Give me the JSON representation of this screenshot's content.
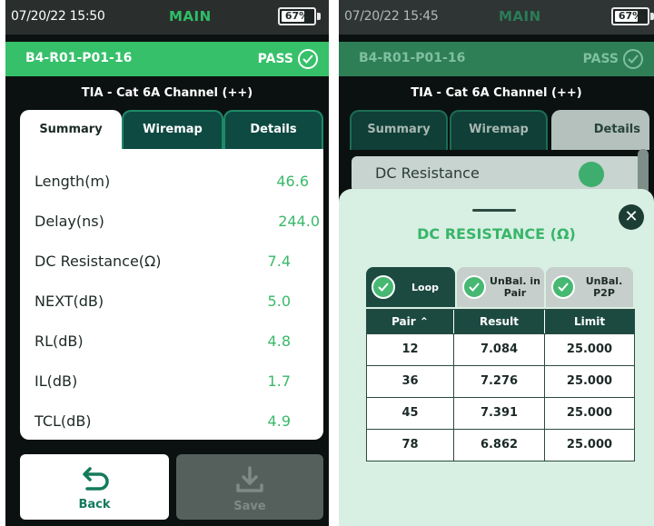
{
  "left": {
    "status": {
      "time": "07/20/22 15:50",
      "mode": "MAIN",
      "battery": "67%"
    },
    "result": {
      "cable_id": "B4-R01-P01-16",
      "status": "PASS"
    },
    "standard": "TIA - Cat 6A Channel (++)",
    "tabs": [
      "Summary",
      "Wiremap",
      "Details"
    ],
    "active_tab": "Summary",
    "rows": [
      {
        "label": "Length(m)",
        "value": "46.6"
      },
      {
        "label": "Delay(ns)",
        "value": "244.0"
      },
      {
        "label": "DC Resistance(Ω)",
        "value": "7.4"
      },
      {
        "label": "NEXT(dB)",
        "value": "5.0"
      },
      {
        "label": "RL(dB)",
        "value": "4.8"
      },
      {
        "label": "IL(dB)",
        "value": "1.7"
      },
      {
        "label": "TCL(dB)",
        "value": "4.9"
      }
    ],
    "buttons": {
      "back": "Back",
      "save": "Save"
    }
  },
  "right": {
    "status": {
      "time": "07/20/22 15:45",
      "mode": "MAIN",
      "battery": "67%"
    },
    "result": {
      "cable_id": "B4-R01-P01-16",
      "status": "PASS"
    },
    "standard": "TIA - Cat 6A Channel (++)",
    "tabs": [
      "Summary",
      "Wiremap",
      "Details"
    ],
    "active_tab": "Details",
    "list_item": "DC Resistance",
    "modal": {
      "title": "DC RESISTANCE (Ω)",
      "subtabs": [
        "Loop",
        "UnBal. in Pair",
        "UnBal. P2P"
      ],
      "columns": [
        "Pair",
        "Result",
        "Limit"
      ],
      "rows": [
        {
          "pair": "12",
          "result": "7.084",
          "limit": "25.000"
        },
        {
          "pair": "36",
          "result": "7.276",
          "limit": "25.000"
        },
        {
          "pair": "45",
          "result": "7.391",
          "limit": "25.000"
        },
        {
          "pair": "78",
          "result": "6.862",
          "limit": "25.000"
        }
      ]
    }
  },
  "colors": {
    "accent_green": "#36c06a",
    "dark_teal": "#1c4a41",
    "panel_bg": "#d8f0e3"
  }
}
